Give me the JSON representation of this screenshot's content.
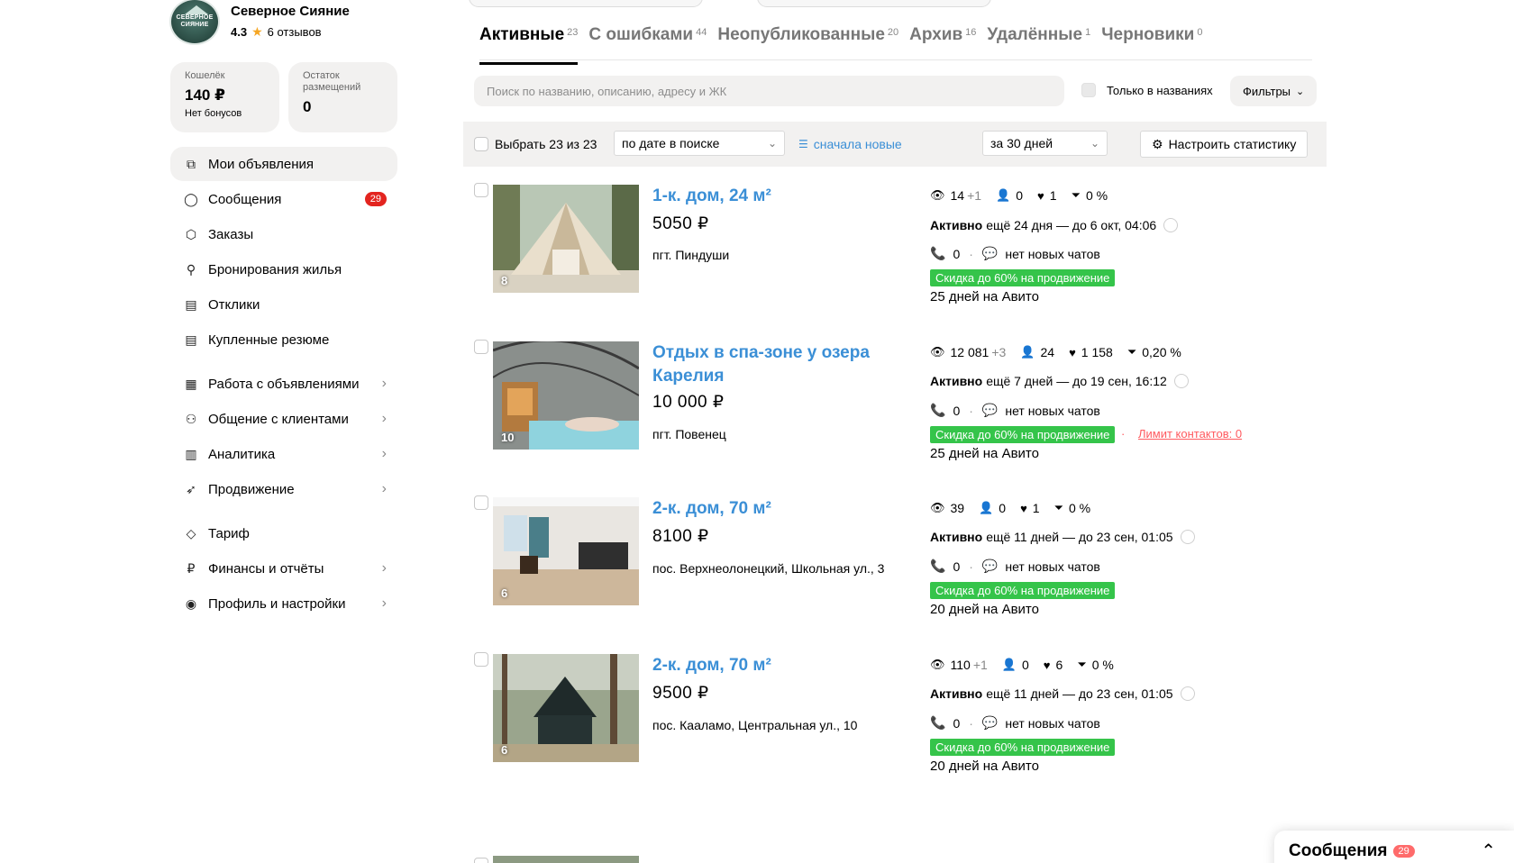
{
  "profile": {
    "name": "Северное Сияние",
    "rating": "4.3",
    "reviews": "6 отзывов",
    "avatar_text": "СЕВЕРНОЕ СИЯНИЕ"
  },
  "wallet": {
    "label": "Кошелёк",
    "value": "140 ₽",
    "sub": "Нет бонусов"
  },
  "placements": {
    "label": "Остаток размещений",
    "value": "0"
  },
  "nav": {
    "my_ads": "Мои объявления",
    "messages": "Сообщения",
    "messages_badge": "29",
    "orders": "Заказы",
    "bookings": "Бронирования жилья",
    "responses": "Отклики",
    "resumes": "Купленные резюме",
    "ads_work": "Работа с объявлениями",
    "clients": "Общение с клиентами",
    "analytics": "Аналитика",
    "promotion": "Продвижение",
    "tariff": "Тариф",
    "finance": "Финансы и отчёты",
    "settings": "Профиль и настройки"
  },
  "tabs": [
    {
      "label": "Активные",
      "count": "23"
    },
    {
      "label": "С ошибками",
      "count": "44"
    },
    {
      "label": "Неопубликованные",
      "count": "20"
    },
    {
      "label": "Архив",
      "count": "16"
    },
    {
      "label": "Удалённые",
      "count": "1"
    },
    {
      "label": "Черновики",
      "count": "0"
    }
  ],
  "search": {
    "placeholder": "Поиск по названию, описанию, адресу и ЖК",
    "title_only": "Только в названиях",
    "filters": "Фильтры"
  },
  "toolbar": {
    "select_all": "Выбрать 23 из 23",
    "sort": "по дате в поиске",
    "order": "сначала новые",
    "period": "за 30 дней",
    "stats_button": "Настроить статистику"
  },
  "listings": [
    {
      "title": "1-к. дом, 24 м²",
      "price": "5050 ₽",
      "address": "пгт. Пиндуши",
      "photos": "8",
      "views": "14",
      "views_delta": "+1",
      "contacts_stat": "0",
      "favs": "1",
      "conv": "0 %",
      "status": "Активно",
      "status_rest": "ещё 24 дня — до 6 окт, 04:06",
      "calls": "0",
      "chats": "нет новых чатов",
      "promo": "Скидка до 60% на продвижение",
      "days": "25 дней на Авито"
    },
    {
      "title": "Отдых в спа-зоне у озера Карелия",
      "price": "10 000 ₽",
      "address": "пгт. Повенец",
      "photos": "10",
      "views": "12 081",
      "views_delta": "+3",
      "contacts_stat": "24",
      "favs": "1 158",
      "conv": "0,20 %",
      "status": "Активно",
      "status_rest": "ещё 7 дней — до 19 сен, 16:12",
      "calls": "0",
      "chats": "нет новых чатов",
      "promo": "Скидка до 60% на продвижение",
      "limit": "Лимит контактов: 0",
      "days": "25 дней на Авито"
    },
    {
      "title": "2-к. дом, 70 м²",
      "price": "8100 ₽",
      "address": "пос. Верхнеолонецкий, Школьная ул., 3",
      "photos": "6",
      "views": "39",
      "views_delta": "",
      "contacts_stat": "0",
      "favs": "1",
      "conv": "0 %",
      "status": "Активно",
      "status_rest": "ещё 11 дней — до 23 сен, 01:05",
      "calls": "0",
      "chats": "нет новых чатов",
      "promo": "Скидка до 60% на продвижение",
      "days": "20 дней на Авито"
    },
    {
      "title": "2-к. дом, 70 м²",
      "price": "9500 ₽",
      "address": "пос. Кааламо, Центральная ул., 10",
      "photos": "6",
      "views": "110",
      "views_delta": "+1",
      "contacts_stat": "0",
      "favs": "6",
      "conv": "0 %",
      "status": "Активно",
      "status_rest": "ещё 11 дней — до 23 сен, 01:05",
      "calls": "0",
      "chats": "нет новых чатов",
      "promo": "Скидка до 60% на продвижение",
      "days": "20 дней на Авито"
    }
  ],
  "messages_widget": {
    "title": "Сообщения",
    "badge": "29"
  },
  "colors": {
    "link": "#3b8fd6",
    "promo": "#35c44a",
    "badge": "#e3241f",
    "limit": "#ff5a5f"
  },
  "icons": [
    "eye-icon",
    "person-icon",
    "heart-icon",
    "funnel-icon",
    "phone-icon",
    "chat-icon",
    "gear-icon",
    "filter-lines-icon",
    "chevron-right-icon",
    "chevron-down-icon",
    "chevron-up-icon",
    "info-circle-icon",
    "star-icon"
  ]
}
